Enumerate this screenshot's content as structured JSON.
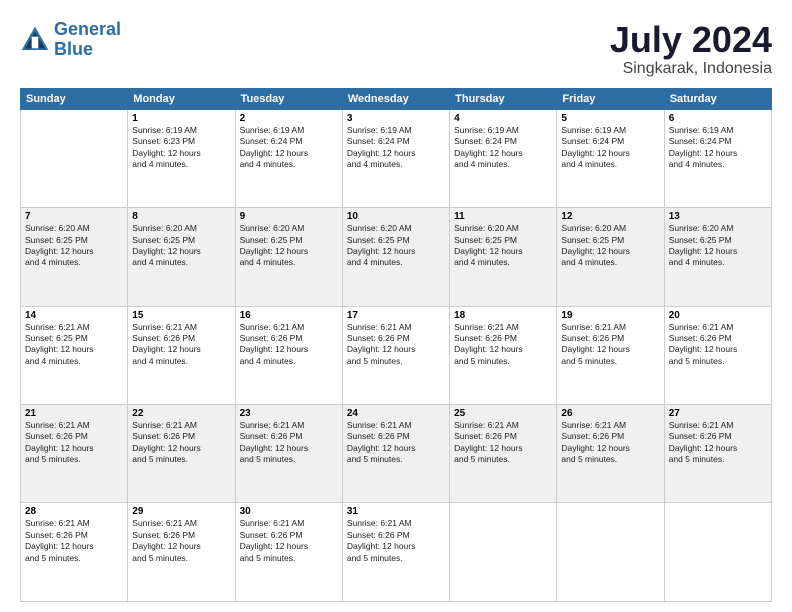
{
  "logo": {
    "line1": "General",
    "line2": "Blue"
  },
  "header": {
    "month": "July 2024",
    "location": "Singkarak, Indonesia"
  },
  "days_of_week": [
    "Sunday",
    "Monday",
    "Tuesday",
    "Wednesday",
    "Thursday",
    "Friday",
    "Saturday"
  ],
  "weeks": [
    [
      {
        "day": "",
        "info": ""
      },
      {
        "day": "1",
        "info": "Sunrise: 6:19 AM\nSunset: 6:23 PM\nDaylight: 12 hours\nand 4 minutes."
      },
      {
        "day": "2",
        "info": "Sunrise: 6:19 AM\nSunset: 6:24 PM\nDaylight: 12 hours\nand 4 minutes."
      },
      {
        "day": "3",
        "info": "Sunrise: 6:19 AM\nSunset: 6:24 PM\nDaylight: 12 hours\nand 4 minutes."
      },
      {
        "day": "4",
        "info": "Sunrise: 6:19 AM\nSunset: 6:24 PM\nDaylight: 12 hours\nand 4 minutes."
      },
      {
        "day": "5",
        "info": "Sunrise: 6:19 AM\nSunset: 6:24 PM\nDaylight: 12 hours\nand 4 minutes."
      },
      {
        "day": "6",
        "info": "Sunrise: 6:19 AM\nSunset: 6:24 PM\nDaylight: 12 hours\nand 4 minutes."
      }
    ],
    [
      {
        "day": "7",
        "info": "Sunrise: 6:20 AM\nSunset: 6:25 PM\nDaylight: 12 hours\nand 4 minutes."
      },
      {
        "day": "8",
        "info": "Sunrise: 6:20 AM\nSunset: 6:25 PM\nDaylight: 12 hours\nand 4 minutes."
      },
      {
        "day": "9",
        "info": "Sunrise: 6:20 AM\nSunset: 6:25 PM\nDaylight: 12 hours\nand 4 minutes."
      },
      {
        "day": "10",
        "info": "Sunrise: 6:20 AM\nSunset: 6:25 PM\nDaylight: 12 hours\nand 4 minutes."
      },
      {
        "day": "11",
        "info": "Sunrise: 6:20 AM\nSunset: 6:25 PM\nDaylight: 12 hours\nand 4 minutes."
      },
      {
        "day": "12",
        "info": "Sunrise: 6:20 AM\nSunset: 6:25 PM\nDaylight: 12 hours\nand 4 minutes."
      },
      {
        "day": "13",
        "info": "Sunrise: 6:20 AM\nSunset: 6:25 PM\nDaylight: 12 hours\nand 4 minutes."
      }
    ],
    [
      {
        "day": "14",
        "info": "Sunrise: 6:21 AM\nSunset: 6:25 PM\nDaylight: 12 hours\nand 4 minutes."
      },
      {
        "day": "15",
        "info": "Sunrise: 6:21 AM\nSunset: 6:26 PM\nDaylight: 12 hours\nand 4 minutes."
      },
      {
        "day": "16",
        "info": "Sunrise: 6:21 AM\nSunset: 6:26 PM\nDaylight: 12 hours\nand 4 minutes."
      },
      {
        "day": "17",
        "info": "Sunrise: 6:21 AM\nSunset: 6:26 PM\nDaylight: 12 hours\nand 5 minutes."
      },
      {
        "day": "18",
        "info": "Sunrise: 6:21 AM\nSunset: 6:26 PM\nDaylight: 12 hours\nand 5 minutes."
      },
      {
        "day": "19",
        "info": "Sunrise: 6:21 AM\nSunset: 6:26 PM\nDaylight: 12 hours\nand 5 minutes."
      },
      {
        "day": "20",
        "info": "Sunrise: 6:21 AM\nSunset: 6:26 PM\nDaylight: 12 hours\nand 5 minutes."
      }
    ],
    [
      {
        "day": "21",
        "info": "Sunrise: 6:21 AM\nSunset: 6:26 PM\nDaylight: 12 hours\nand 5 minutes."
      },
      {
        "day": "22",
        "info": "Sunrise: 6:21 AM\nSunset: 6:26 PM\nDaylight: 12 hours\nand 5 minutes."
      },
      {
        "day": "23",
        "info": "Sunrise: 6:21 AM\nSunset: 6:26 PM\nDaylight: 12 hours\nand 5 minutes."
      },
      {
        "day": "24",
        "info": "Sunrise: 6:21 AM\nSunset: 6:26 PM\nDaylight: 12 hours\nand 5 minutes."
      },
      {
        "day": "25",
        "info": "Sunrise: 6:21 AM\nSunset: 6:26 PM\nDaylight: 12 hours\nand 5 minutes."
      },
      {
        "day": "26",
        "info": "Sunrise: 6:21 AM\nSunset: 6:26 PM\nDaylight: 12 hours\nand 5 minutes."
      },
      {
        "day": "27",
        "info": "Sunrise: 6:21 AM\nSunset: 6:26 PM\nDaylight: 12 hours\nand 5 minutes."
      }
    ],
    [
      {
        "day": "28",
        "info": "Sunrise: 6:21 AM\nSunset: 6:26 PM\nDaylight: 12 hours\nand 5 minutes."
      },
      {
        "day": "29",
        "info": "Sunrise: 6:21 AM\nSunset: 6:26 PM\nDaylight: 12 hours\nand 5 minutes."
      },
      {
        "day": "30",
        "info": "Sunrise: 6:21 AM\nSunset: 6:26 PM\nDaylight: 12 hours\nand 5 minutes."
      },
      {
        "day": "31",
        "info": "Sunrise: 6:21 AM\nSunset: 6:26 PM\nDaylight: 12 hours\nand 5 minutes."
      },
      {
        "day": "",
        "info": ""
      },
      {
        "day": "",
        "info": ""
      },
      {
        "day": "",
        "info": ""
      }
    ]
  ]
}
